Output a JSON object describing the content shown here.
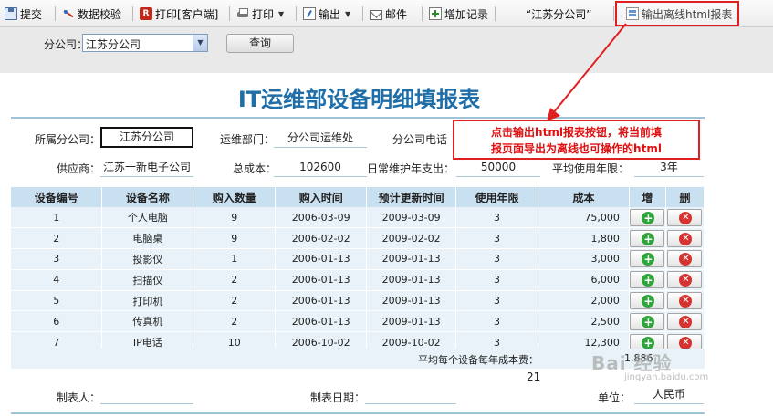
{
  "toolbar": {
    "submit": "提交",
    "validate": "数据校验",
    "print_client": "打印[客户端]",
    "print": "打印",
    "export": "输出",
    "mail": "邮件",
    "add_record": "增加记录",
    "current_company": "“江苏分公司”",
    "export_html": "输出离线html报表"
  },
  "query": {
    "branch_label": "分公司：",
    "branch_value": "江苏分公司",
    "search_button": "查询"
  },
  "report": {
    "title": "IT运维部设备明细填报表",
    "fields": {
      "branch_label": "所属分公司：",
      "branch_value": "江苏分公司",
      "dept_label": "运维部门：",
      "dept_value": "分公司运维处",
      "phone_label": "分公司电话",
      "supplier_label": "供应商：",
      "supplier_value": "江苏一新电子公司",
      "total_cost_label": "总成本：",
      "total_cost_value": "102600",
      "maint_label": "日常维护年支出：",
      "maint_value": "50000",
      "avg_years_label": "平均使用年限：",
      "avg_years_value": "3年"
    },
    "columns": [
      "设备编号",
      "设备名称",
      "购入数量",
      "购入时间",
      "预计更新时间",
      "使用年限",
      "成本",
      "增",
      "删"
    ],
    "rows": [
      {
        "id": "1",
        "name": "个人电脑",
        "qty": "9",
        "buy": "2006-03-09",
        "renew": "2009-03-09",
        "years": "3",
        "cost": "75,000"
      },
      {
        "id": "2",
        "name": "电脑桌",
        "qty": "9",
        "buy": "2006-02-02",
        "renew": "2009-02-02",
        "years": "3",
        "cost": "1,800"
      },
      {
        "id": "3",
        "name": "投影仪",
        "qty": "1",
        "buy": "2006-01-13",
        "renew": "2009-01-13",
        "years": "3",
        "cost": "3,000"
      },
      {
        "id": "4",
        "name": "扫描仪",
        "qty": "2",
        "buy": "2006-01-13",
        "renew": "2009-01-13",
        "years": "3",
        "cost": "6,000"
      },
      {
        "id": "5",
        "name": "打印机",
        "qty": "2",
        "buy": "2006-01-13",
        "renew": "2009-01-13",
        "years": "3",
        "cost": "2,000"
      },
      {
        "id": "6",
        "name": "传真机",
        "qty": "2",
        "buy": "2006-01-13",
        "renew": "2009-01-13",
        "years": "3",
        "cost": "2,500"
      },
      {
        "id": "7",
        "name": "IP电话",
        "qty": "10",
        "buy": "2006-10-02",
        "renew": "2009-10-02",
        "years": "3",
        "cost": "12,300"
      }
    ],
    "summary_label": "平均每个设备每年成本费：",
    "summary_value": "1,886",
    "page_number": "21",
    "footer": {
      "maker_label": "制表人：",
      "date_label": "制表日期：",
      "unit_label": "单位：",
      "unit_value": "人民币"
    }
  },
  "annotation": {
    "line1": "点击输出html报表按钮，将当前填",
    "line2": "报页面导出为离线也可操作的html"
  },
  "watermark": {
    "text": "Bai 经验",
    "sub": "jingyan.baidu.com"
  },
  "colors": {
    "title": "#1f6ea8",
    "header_bg": "#c9e0f0",
    "row_bg": "#e8f2f8",
    "annotation_red": "#e02020"
  }
}
